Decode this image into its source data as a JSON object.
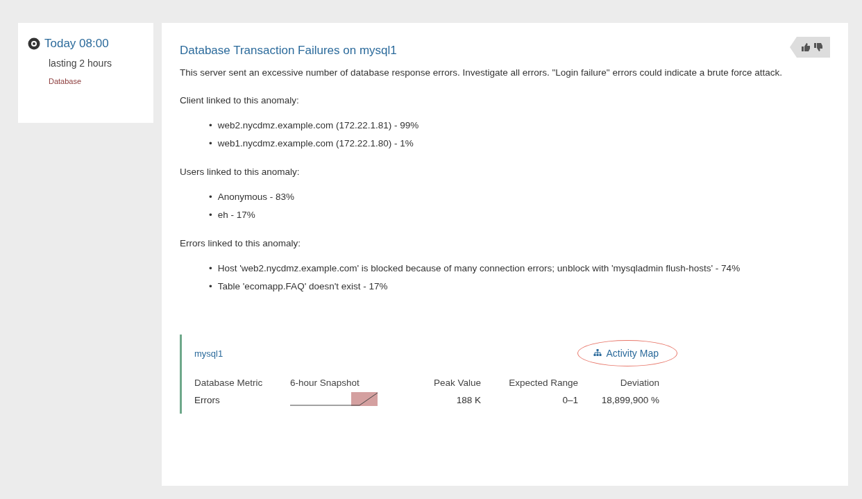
{
  "event": {
    "time": "Today 08:00",
    "duration": "lasting 2 hours",
    "category": "Database"
  },
  "detail": {
    "title": "Database Transaction Failures on mysql1",
    "description": "This server sent an excessive number of database response errors. Investigate all errors. \"Login failure\" errors could indicate a brute force attack.",
    "sections": [
      {
        "heading": "Client linked to this anomaly:",
        "items": [
          {
            "bullet": "•",
            "text": "web2.nycdmz.example.com (172.22.1.81) - 99%"
          },
          {
            "bullet": "•",
            "text": "web1.nycdmz.example.com (172.22.1.80) - 1%"
          }
        ]
      },
      {
        "heading": "Users linked to this anomaly:",
        "items": [
          {
            "bullet": "•",
            "text": "Anonymous - 83%"
          },
          {
            "bullet": "•",
            "text": "eh - 17%"
          }
        ]
      },
      {
        "heading": "Errors linked to this anomaly:",
        "items": [
          {
            "bullet": "•",
            "text": "Host 'web2.nycdmz.example.com' is blocked because of many connection errors; unblock with 'mysqladmin flush-hosts' - 74%"
          },
          {
            "bullet": "•",
            "text": "Table 'ecomapp.FAQ' doesn't exist - 17%"
          }
        ]
      }
    ],
    "metrics": {
      "device": "mysql1",
      "activity_map": {
        "label": "Activity Map",
        "circled": true
      },
      "columns": [
        "Database Metric",
        "6-hour Snapshot",
        "Peak Value",
        "Expected Range",
        "Deviation"
      ],
      "rows": [
        {
          "metric": "Errors",
          "peak": "188 K",
          "range": "0–1",
          "deviation": "18,899,900 %"
        }
      ]
    }
  }
}
